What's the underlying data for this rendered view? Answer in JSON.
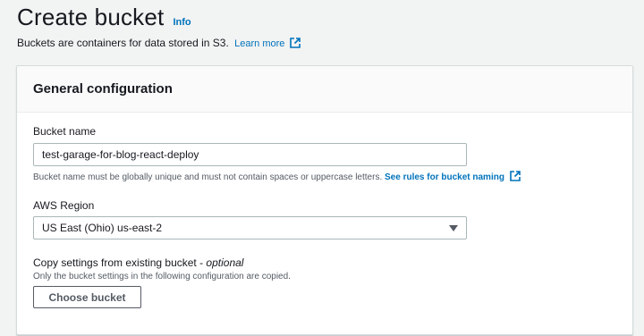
{
  "header": {
    "title": "Create bucket",
    "info_label": "Info",
    "subtitle": "Buckets are containers for data stored in S3.",
    "learn_more": "Learn more"
  },
  "panel": {
    "title": "General configuration",
    "bucket_name": {
      "label": "Bucket name",
      "value": "test-garage-for-blog-react-deploy",
      "hint": "Bucket name must be globally unique and must not contain spaces or uppercase letters.",
      "hint_link": "See rules for bucket naming"
    },
    "region": {
      "label": "AWS Region",
      "selected": "US East (Ohio) us-east-2"
    },
    "copy_settings": {
      "label": "Copy settings from existing bucket -",
      "label_optional": "optional",
      "description": "Only the bucket settings in the following configuration are copied.",
      "button": "Choose bucket"
    }
  },
  "colors": {
    "link": "#0073bb",
    "background": "#f2f3f3",
    "panel_header": "#fafafa",
    "text": "#16191f"
  },
  "icons": [
    "external-link-icon",
    "caret-down-icon"
  ]
}
